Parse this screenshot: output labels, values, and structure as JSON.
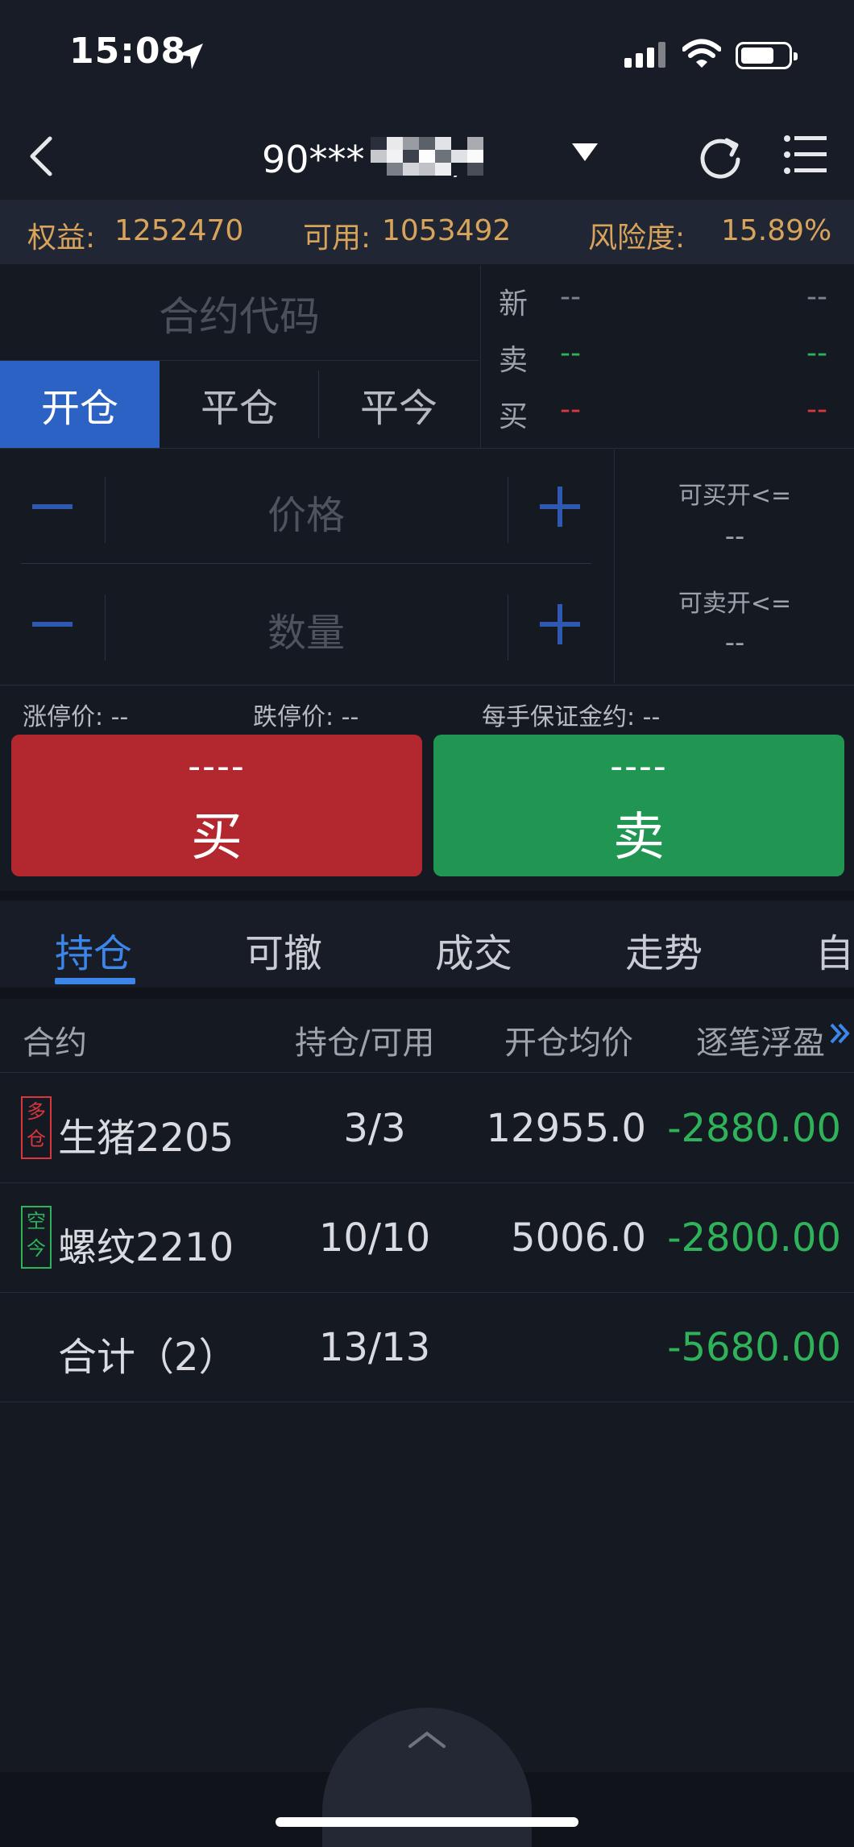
{
  "status_bar": {
    "time": "15:08"
  },
  "header": {
    "account_title": "90***          期货)"
  },
  "account_bar": {
    "equity_label": "权益:",
    "equity_value": "1252470",
    "available_label": "可用:",
    "available_value": "1053492",
    "risk_label": "风险度:",
    "risk_value": "15.89%"
  },
  "order_form": {
    "contract_placeholder": "合约代码",
    "tabs": [
      "开仓",
      "平仓",
      "平今"
    ],
    "active_tab": "开仓",
    "price_placeholder": "价格",
    "qty_placeholder": "数量",
    "can_buy_open_label": "可买开<=",
    "can_buy_open_value": "--",
    "can_sell_open_label": "可卖开<=",
    "can_sell_open_value": "--",
    "limit_up": "涨停价:  --",
    "limit_down": "跌停价:  --",
    "margin_per_lot": "每手保证金约:  --",
    "buy_price": "----",
    "buy_label": "买",
    "sell_price": "----",
    "sell_label": "卖"
  },
  "quote": {
    "rows": [
      {
        "label": "新",
        "v1": "--",
        "v2": "--",
        "color": "#7d828c"
      },
      {
        "label": "卖",
        "v1": "--",
        "v2": "--",
        "color": "#2fb35a"
      },
      {
        "label": "买",
        "v1": "--",
        "v2": "--",
        "color": "#d9363e"
      }
    ]
  },
  "position_tabs": [
    "持仓",
    "可撤",
    "成交",
    "走势",
    "自"
  ],
  "positions_table": {
    "headers": [
      "合约",
      "持仓/可用",
      "开仓均价",
      "逐笔浮盈"
    ],
    "rows": [
      {
        "tag": "多仓",
        "tag_type": "long",
        "name": "生猪2205",
        "qty": "3/3",
        "avg": "12955.0",
        "pnl": "-2880.00"
      },
      {
        "tag": "空今",
        "tag_type": "short",
        "name": "螺纹2210",
        "qty": "10/10",
        "avg": "5006.0",
        "pnl": "-2800.00"
      }
    ],
    "total": {
      "name": "合计（2）",
      "qty": "13/13",
      "pnl": "-5680.00"
    }
  },
  "colors": {
    "accent_blue": "#3b86e8",
    "buy_red": "#b3282f",
    "sell_green": "#219653",
    "account_gold": "#d8a35a"
  }
}
